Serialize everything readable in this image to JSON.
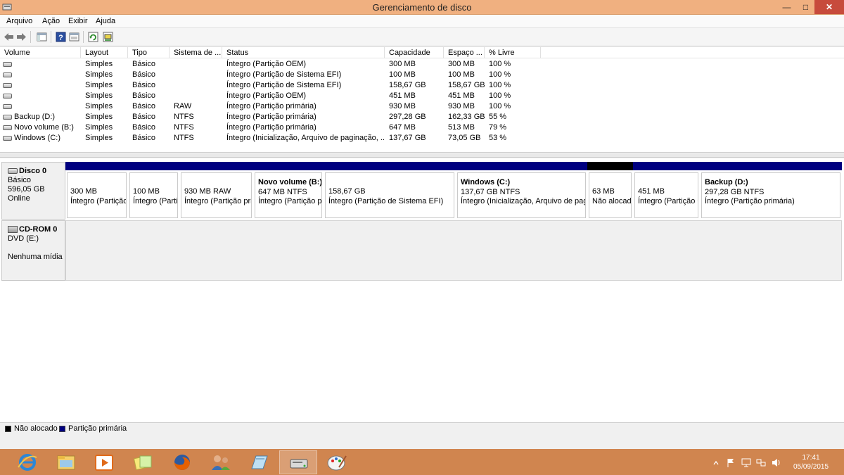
{
  "window": {
    "title": "Gerenciamento de disco",
    "minimize_glyph": "—",
    "maximize_glyph": "□",
    "close_glyph": "✕"
  },
  "menu": [
    "Arquivo",
    "Ação",
    "Exibir",
    "Ajuda"
  ],
  "toolbar_icons": [
    "back-icon",
    "forward-icon",
    "console-tree-icon",
    "help-icon",
    "properties-icon",
    "refresh-icon",
    "rescan-icon"
  ],
  "volume_table": {
    "columns": [
      "Volume",
      "Layout",
      "Tipo",
      "Sistema de ...",
      "Status",
      "Capacidade",
      "Espaço ...",
      "% Livre"
    ],
    "rows": [
      {
        "volume": "",
        "layout": "Simples",
        "tipo": "Básico",
        "fs": "",
        "status": "Íntegro (Partição OEM)",
        "capacidade": "300 MB",
        "espaco": "300 MB",
        "livre": "100 %"
      },
      {
        "volume": "",
        "layout": "Simples",
        "tipo": "Básico",
        "fs": "",
        "status": "Íntegro (Partição de Sistema EFI)",
        "capacidade": "100 MB",
        "espaco": "100 MB",
        "livre": "100 %"
      },
      {
        "volume": "",
        "layout": "Simples",
        "tipo": "Básico",
        "fs": "",
        "status": "Íntegro (Partição de Sistema EFI)",
        "capacidade": "158,67 GB",
        "espaco": "158,67 GB",
        "livre": "100 %"
      },
      {
        "volume": "",
        "layout": "Simples",
        "tipo": "Básico",
        "fs": "",
        "status": "Íntegro (Partição OEM)",
        "capacidade": "451 MB",
        "espaco": "451 MB",
        "livre": "100 %"
      },
      {
        "volume": "",
        "layout": "Simples",
        "tipo": "Básico",
        "fs": "RAW",
        "status": "Íntegro (Partição primária)",
        "capacidade": "930 MB",
        "espaco": "930 MB",
        "livre": "100 %"
      },
      {
        "volume": "Backup (D:)",
        "layout": "Simples",
        "tipo": "Básico",
        "fs": "NTFS",
        "status": "Íntegro (Partição primária)",
        "capacidade": "297,28 GB",
        "espaco": "162,33 GB",
        "livre": "55 %"
      },
      {
        "volume": "Novo volume (B:)",
        "layout": "Simples",
        "tipo": "Básico",
        "fs": "NTFS",
        "status": "Íntegro (Partição primária)",
        "capacidade": "647 MB",
        "espaco": "513 MB",
        "livre": "79 %"
      },
      {
        "volume": "Windows (C:)",
        "layout": "Simples",
        "tipo": "Básico",
        "fs": "NTFS",
        "status": "Íntegro (Inicialização, Arquivo de paginação, ...",
        "capacidade": "137,67 GB",
        "espaco": "73,05 GB",
        "livre": "53 %"
      }
    ]
  },
  "disk0": {
    "name": "Disco 0",
    "type": "Básico",
    "size": "596,05 GB",
    "state": "Online",
    "partitions": [
      {
        "name": "",
        "size": "300 MB",
        "status": "Íntegro (Partição OEM)",
        "kind": "primary"
      },
      {
        "name": "",
        "size": "100 MB",
        "status": "Íntegro (Partição de Sistema EFI)",
        "kind": "primary"
      },
      {
        "name": "",
        "size": "930 MB RAW",
        "status": "Íntegro (Partição primária)",
        "kind": "primary"
      },
      {
        "name": "Novo volume  (B:)",
        "size": "647 MB NTFS",
        "status": "Íntegro (Partição primária)",
        "kind": "primary"
      },
      {
        "name": "",
        "size": "158,67 GB",
        "status": "Íntegro (Partição de Sistema EFI)",
        "kind": "primary"
      },
      {
        "name": "Windows  (C:)",
        "size": "137,67 GB NTFS",
        "status": "Íntegro (Inicialização, Arquivo de paginação, ...",
        "kind": "primary"
      },
      {
        "name": "",
        "size": "63 MB",
        "status": "Não alocado",
        "kind": "unallocated"
      },
      {
        "name": "",
        "size": "451 MB",
        "status": "Íntegro (Partição OEM)",
        "kind": "primary"
      },
      {
        "name": "Backup  (D:)",
        "size": "297,28 GB NTFS",
        "status": "Íntegro (Partição primária)",
        "kind": "primary"
      }
    ]
  },
  "cdrom0": {
    "name": "CD-ROM 0",
    "drive": "DVD (E:)",
    "media": "Nenhuma mídia"
  },
  "legend": {
    "unallocated_label": "Não alocado",
    "primary_label": "Partição primária",
    "unallocated_color": "#000000",
    "primary_color": "#000080"
  },
  "taskbar": {
    "apps": [
      "internet-explorer-icon",
      "file-explorer-icon",
      "media-player-icon",
      "sticky-notes-icon",
      "firefox-icon",
      "users-icon",
      "book-icon",
      "disk-management-icon",
      "paint-icon"
    ],
    "clock_time": "17:41",
    "clock_date": "05/09/2015",
    "tray_icons": [
      "chevron-up-icon",
      "flag-icon",
      "monitor-icon",
      "network-icon",
      "volume-icon"
    ]
  }
}
